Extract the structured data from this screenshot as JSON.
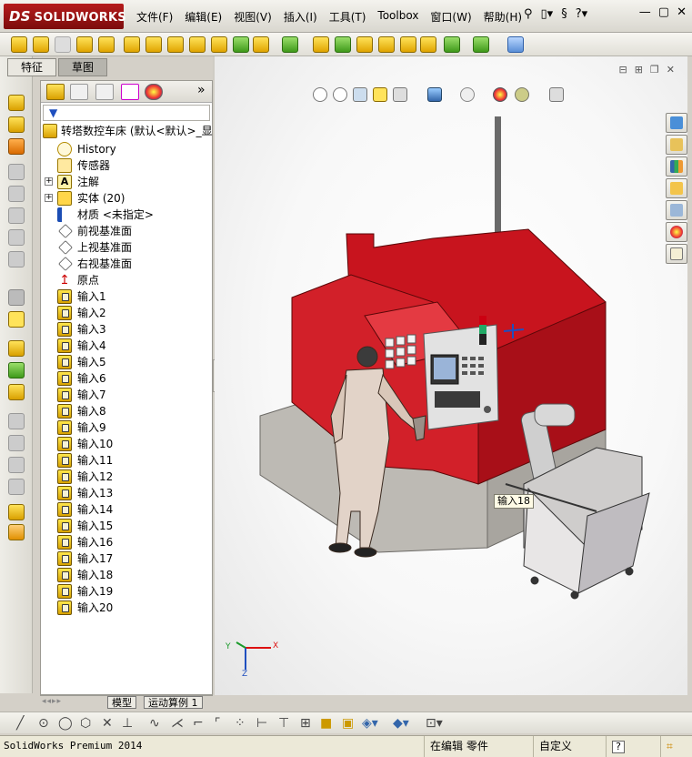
{
  "app": {
    "logo_text": "SOLIDWORKS",
    "logo_prefix": "DS"
  },
  "menu": {
    "items": [
      "文件(F)",
      "编辑(E)",
      "视图(V)",
      "插入(I)",
      "工具(T)",
      "Toolbox",
      "窗口(W)",
      "帮助(H)"
    ]
  },
  "left_tabs": {
    "features": "特征",
    "sketch": "草图"
  },
  "tree": {
    "root_label": "转塔数控车床  (默认<默认>_显",
    "items": [
      {
        "label": "History",
        "icon": "history-icon",
        "type": "history",
        "expandable": false
      },
      {
        "label": "传感器",
        "icon": "sensor-icon",
        "type": "sensor",
        "expandable": false
      },
      {
        "label": "注解",
        "icon": "annotation-icon",
        "type": "annot",
        "expandable": true
      },
      {
        "label": "实体 (20)",
        "icon": "solid-bodies-icon",
        "type": "solid",
        "expandable": true
      },
      {
        "label": "材质 <未指定>",
        "icon": "material-icon",
        "type": "material",
        "expandable": false
      },
      {
        "label": "前视基准面",
        "icon": "plane-icon",
        "type": "plane",
        "expandable": false
      },
      {
        "label": "上视基准面",
        "icon": "plane-icon",
        "type": "plane",
        "expandable": false
      },
      {
        "label": "右视基准面",
        "icon": "plane-icon",
        "type": "plane",
        "expandable": false
      },
      {
        "label": "原点",
        "icon": "origin-icon",
        "type": "origin",
        "expandable": false
      },
      {
        "label": "输入1",
        "icon": "imported-body-icon",
        "type": "input",
        "expandable": false
      },
      {
        "label": "输入2",
        "icon": "imported-body-icon",
        "type": "input",
        "expandable": false
      },
      {
        "label": "输入3",
        "icon": "imported-body-icon",
        "type": "input",
        "expandable": false
      },
      {
        "label": "输入4",
        "icon": "imported-body-icon",
        "type": "input",
        "expandable": false
      },
      {
        "label": "输入5",
        "icon": "imported-body-icon",
        "type": "input",
        "expandable": false
      },
      {
        "label": "输入6",
        "icon": "imported-body-icon",
        "type": "input",
        "expandable": false
      },
      {
        "label": "输入7",
        "icon": "imported-body-icon",
        "type": "input",
        "expandable": false
      },
      {
        "label": "输入8",
        "icon": "imported-body-icon",
        "type": "input",
        "expandable": false
      },
      {
        "label": "输入9",
        "icon": "imported-body-icon",
        "type": "input",
        "expandable": false
      },
      {
        "label": "输入10",
        "icon": "imported-body-icon",
        "type": "input",
        "expandable": false
      },
      {
        "label": "输入11",
        "icon": "imported-body-icon",
        "type": "input",
        "expandable": false
      },
      {
        "label": "输入12",
        "icon": "imported-body-icon",
        "type": "input",
        "expandable": false
      },
      {
        "label": "输入13",
        "icon": "imported-body-icon",
        "type": "input",
        "expandable": false
      },
      {
        "label": "输入14",
        "icon": "imported-body-icon",
        "type": "input",
        "expandable": false
      },
      {
        "label": "输入15",
        "icon": "imported-body-icon",
        "type": "input",
        "expandable": false
      },
      {
        "label": "输入16",
        "icon": "imported-body-icon",
        "type": "input",
        "expandable": false
      },
      {
        "label": "输入17",
        "icon": "imported-body-icon",
        "type": "input",
        "expandable": false
      },
      {
        "label": "输入18",
        "icon": "imported-body-icon",
        "type": "input",
        "expandable": false
      },
      {
        "label": "输入19",
        "icon": "imported-body-icon",
        "type": "input",
        "expandable": false
      },
      {
        "label": "输入20",
        "icon": "imported-body-icon",
        "type": "input",
        "expandable": false
      }
    ]
  },
  "bottom_tabs": {
    "model": "模型",
    "motion": "运动算例 1"
  },
  "viewport": {
    "callout": "输入18"
  },
  "triad": {
    "x": "X",
    "y": "Y",
    "z": "Z"
  },
  "status": {
    "product": "SolidWorks Premium 2014",
    "editing": "在编辑 零件",
    "units": "自定义",
    "help": "?"
  },
  "colors": {
    "machine_red": "#c8141e",
    "machine_gray": "#bdbab4",
    "accent_blue": "#1f4fbf",
    "logo_red": "#a51818"
  }
}
